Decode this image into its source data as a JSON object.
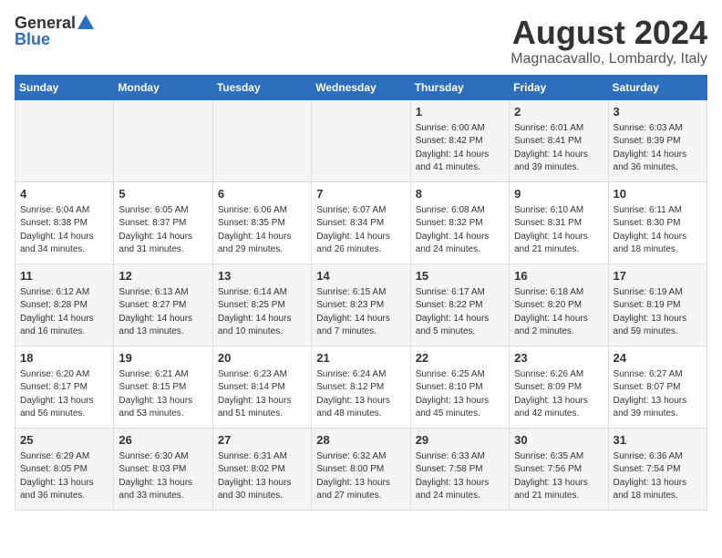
{
  "logo": {
    "general": "General",
    "blue": "Blue"
  },
  "title": "August 2024",
  "subtitle": "Magnacavallo, Lombardy, Italy",
  "days_of_week": [
    "Sunday",
    "Monday",
    "Tuesday",
    "Wednesday",
    "Thursday",
    "Friday",
    "Saturday"
  ],
  "weeks": [
    [
      {
        "day": "",
        "info": ""
      },
      {
        "day": "",
        "info": ""
      },
      {
        "day": "",
        "info": ""
      },
      {
        "day": "",
        "info": ""
      },
      {
        "day": "1",
        "info": "Sunrise: 6:00 AM\nSunset: 8:42 PM\nDaylight: 14 hours\nand 41 minutes."
      },
      {
        "day": "2",
        "info": "Sunrise: 6:01 AM\nSunset: 8:41 PM\nDaylight: 14 hours\nand 39 minutes."
      },
      {
        "day": "3",
        "info": "Sunrise: 6:03 AM\nSunset: 8:39 PM\nDaylight: 14 hours\nand 36 minutes."
      }
    ],
    [
      {
        "day": "4",
        "info": "Sunrise: 6:04 AM\nSunset: 8:38 PM\nDaylight: 14 hours\nand 34 minutes."
      },
      {
        "day": "5",
        "info": "Sunrise: 6:05 AM\nSunset: 8:37 PM\nDaylight: 14 hours\nand 31 minutes."
      },
      {
        "day": "6",
        "info": "Sunrise: 6:06 AM\nSunset: 8:35 PM\nDaylight: 14 hours\nand 29 minutes."
      },
      {
        "day": "7",
        "info": "Sunrise: 6:07 AM\nSunset: 8:34 PM\nDaylight: 14 hours\nand 26 minutes."
      },
      {
        "day": "8",
        "info": "Sunrise: 6:08 AM\nSunset: 8:32 PM\nDaylight: 14 hours\nand 24 minutes."
      },
      {
        "day": "9",
        "info": "Sunrise: 6:10 AM\nSunset: 8:31 PM\nDaylight: 14 hours\nand 21 minutes."
      },
      {
        "day": "10",
        "info": "Sunrise: 6:11 AM\nSunset: 8:30 PM\nDaylight: 14 hours\nand 18 minutes."
      }
    ],
    [
      {
        "day": "11",
        "info": "Sunrise: 6:12 AM\nSunset: 8:28 PM\nDaylight: 14 hours\nand 16 minutes."
      },
      {
        "day": "12",
        "info": "Sunrise: 6:13 AM\nSunset: 8:27 PM\nDaylight: 14 hours\nand 13 minutes."
      },
      {
        "day": "13",
        "info": "Sunrise: 6:14 AM\nSunset: 8:25 PM\nDaylight: 14 hours\nand 10 minutes."
      },
      {
        "day": "14",
        "info": "Sunrise: 6:15 AM\nSunset: 8:23 PM\nDaylight: 14 hours\nand 7 minutes."
      },
      {
        "day": "15",
        "info": "Sunrise: 6:17 AM\nSunset: 8:22 PM\nDaylight: 14 hours\nand 5 minutes."
      },
      {
        "day": "16",
        "info": "Sunrise: 6:18 AM\nSunset: 8:20 PM\nDaylight: 14 hours\nand 2 minutes."
      },
      {
        "day": "17",
        "info": "Sunrise: 6:19 AM\nSunset: 8:19 PM\nDaylight: 13 hours\nand 59 minutes."
      }
    ],
    [
      {
        "day": "18",
        "info": "Sunrise: 6:20 AM\nSunset: 8:17 PM\nDaylight: 13 hours\nand 56 minutes."
      },
      {
        "day": "19",
        "info": "Sunrise: 6:21 AM\nSunset: 8:15 PM\nDaylight: 13 hours\nand 53 minutes."
      },
      {
        "day": "20",
        "info": "Sunrise: 6:23 AM\nSunset: 8:14 PM\nDaylight: 13 hours\nand 51 minutes."
      },
      {
        "day": "21",
        "info": "Sunrise: 6:24 AM\nSunset: 8:12 PM\nDaylight: 13 hours\nand 48 minutes."
      },
      {
        "day": "22",
        "info": "Sunrise: 6:25 AM\nSunset: 8:10 PM\nDaylight: 13 hours\nand 45 minutes."
      },
      {
        "day": "23",
        "info": "Sunrise: 6:26 AM\nSunset: 8:09 PM\nDaylight: 13 hours\nand 42 minutes."
      },
      {
        "day": "24",
        "info": "Sunrise: 6:27 AM\nSunset: 8:07 PM\nDaylight: 13 hours\nand 39 minutes."
      }
    ],
    [
      {
        "day": "25",
        "info": "Sunrise: 6:29 AM\nSunset: 8:05 PM\nDaylight: 13 hours\nand 36 minutes."
      },
      {
        "day": "26",
        "info": "Sunrise: 6:30 AM\nSunset: 8:03 PM\nDaylight: 13 hours\nand 33 minutes."
      },
      {
        "day": "27",
        "info": "Sunrise: 6:31 AM\nSunset: 8:02 PM\nDaylight: 13 hours\nand 30 minutes."
      },
      {
        "day": "28",
        "info": "Sunrise: 6:32 AM\nSunset: 8:00 PM\nDaylight: 13 hours\nand 27 minutes."
      },
      {
        "day": "29",
        "info": "Sunrise: 6:33 AM\nSunset: 7:58 PM\nDaylight: 13 hours\nand 24 minutes."
      },
      {
        "day": "30",
        "info": "Sunrise: 6:35 AM\nSunset: 7:56 PM\nDaylight: 13 hours\nand 21 minutes."
      },
      {
        "day": "31",
        "info": "Sunrise: 6:36 AM\nSunset: 7:54 PM\nDaylight: 13 hours\nand 18 minutes."
      }
    ]
  ]
}
